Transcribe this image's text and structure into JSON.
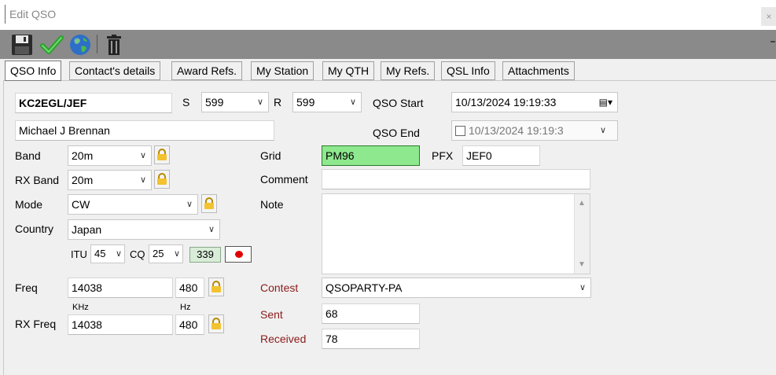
{
  "window": {
    "title": "Edit QSO",
    "close_label": "×"
  },
  "toolbar": {
    "buttons": [
      {
        "name": "save-button",
        "icon": "floppy-disk-icon"
      },
      {
        "name": "confirm-button",
        "icon": "green-checkmark-icon"
      },
      {
        "name": "lookup-button",
        "icon": "globe-icon"
      },
      {
        "name": "delete-button",
        "icon": "trash-icon"
      }
    ]
  },
  "tabs": [
    {
      "label": "QSO Info",
      "active": true
    },
    {
      "label": "Contact's details"
    },
    {
      "label": "Award Refs."
    },
    {
      "label": "My Station"
    },
    {
      "label": "My QTH"
    },
    {
      "label": "My Refs."
    },
    {
      "label": "QSL Info"
    },
    {
      "label": "Attachments"
    }
  ],
  "qso": {
    "callsign": "KC2EGL/JEF",
    "name": "Michael J Brennan",
    "s_label": "S",
    "s_value": "599",
    "r_label": "R",
    "r_value": "599",
    "start_label": "QSO Start",
    "start_value": "10/13/2024 19:19:33",
    "end_label": "QSO End",
    "end_value": "10/13/2024 19:19:3",
    "band_label": "Band",
    "band_value": "20m",
    "rxband_label": "RX Band",
    "rxband_value": "20m",
    "mode_label": "Mode",
    "mode_value": "CW",
    "country_label": "Country",
    "country_value": "Japan",
    "itu_label": "ITU",
    "itu_value": "45",
    "cq_label": "CQ",
    "cq_value": "25",
    "dxcc_value": "339",
    "freq_label": "Freq",
    "freq_value": "14038",
    "freq_hz": "480",
    "khz_label": "KHz",
    "hz_label": "Hz",
    "rxfreq_label": "RX Freq",
    "rxfreq_value": "14038",
    "rxfreq_hz": "480",
    "grid_label": "Grid",
    "grid_value": "PM96",
    "pfx_label": "PFX",
    "pfx_value": "JEF0",
    "comment_label": "Comment",
    "comment_value": "",
    "note_label": "Note",
    "note_value": "",
    "contest_label": "Contest",
    "contest_value": "QSOPARTY-PA",
    "sent_label": "Sent",
    "sent_value": "68",
    "received_label": "Received",
    "received_value": "78"
  },
  "colors": {
    "grid_fill": "#8ee88e",
    "contest_label": "#8b1a1a",
    "toolbar": "#8a8a8a"
  }
}
